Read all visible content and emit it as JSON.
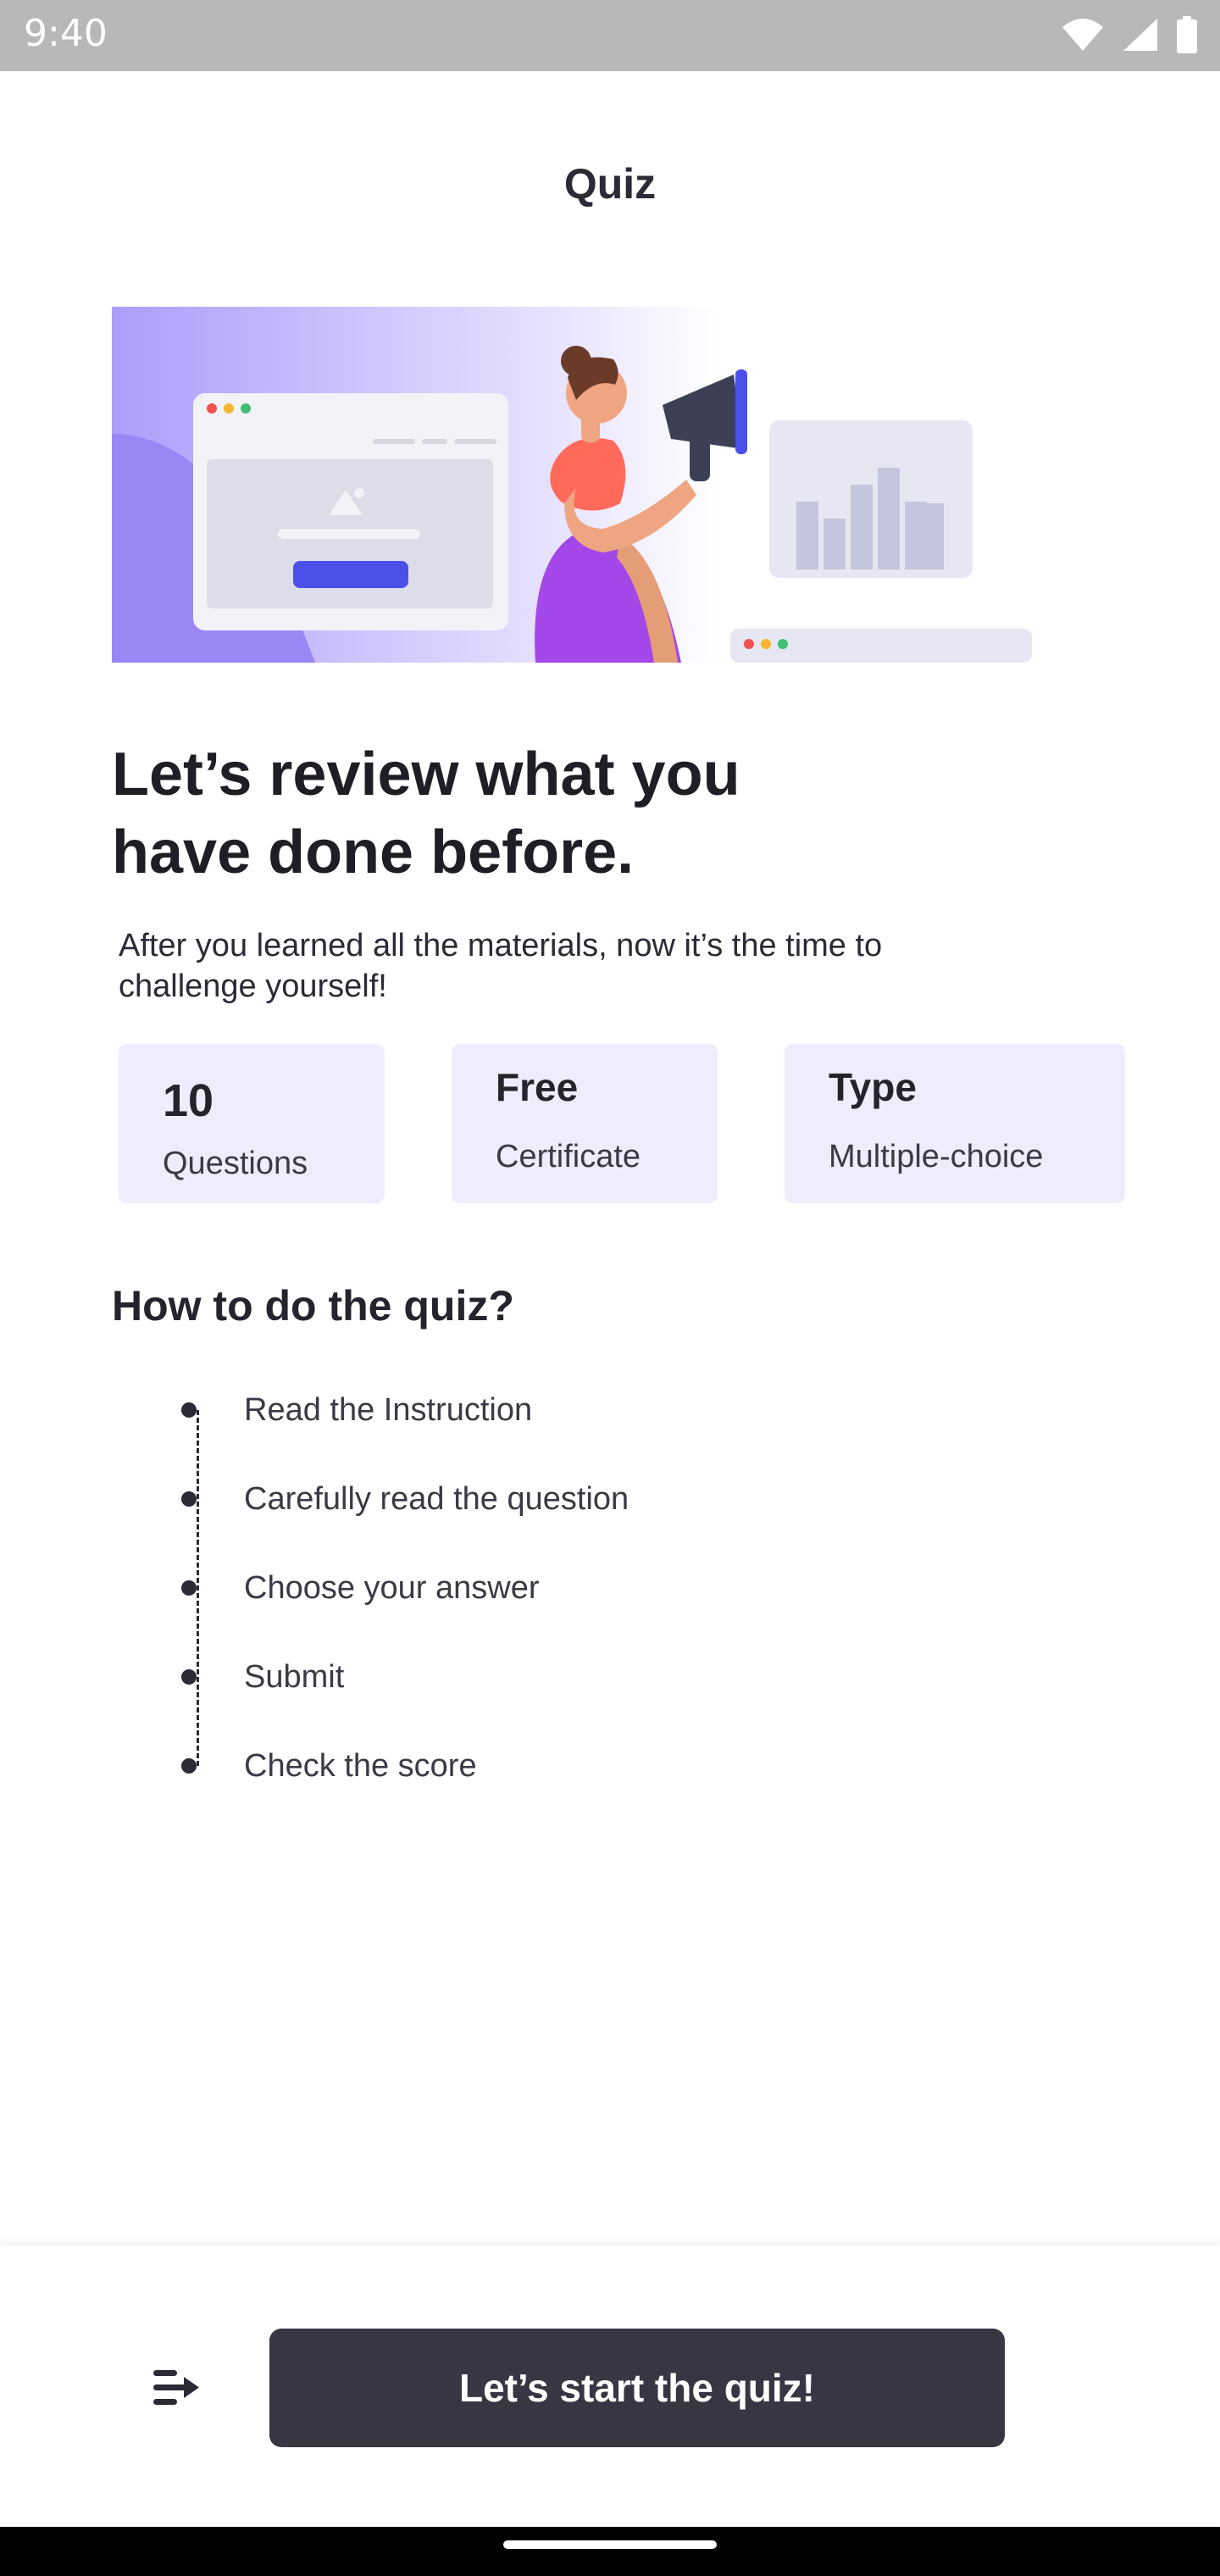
{
  "status_bar": {
    "time": "9:40",
    "icons": [
      "wifi-icon",
      "signal-icon",
      "battery-icon"
    ]
  },
  "header": {
    "title": "Quiz"
  },
  "hero": {
    "illustration": "megaphone-woman-illustration",
    "bg_color": "#ac9dfb",
    "accent_color": "#a347e8"
  },
  "headline": {
    "line1": "Let’s review what you",
    "line2": "have done before."
  },
  "subtitle": {
    "line1": "After you learned all the materials, now it’s the time to",
    "line2": "challenge yourself!"
  },
  "info_cards": [
    {
      "value": "10",
      "label": "Questions"
    },
    {
      "value": "Free",
      "label": "Certificate"
    },
    {
      "value": "Type",
      "label": "Multiple-choice"
    }
  ],
  "how_to": {
    "title": "How to do the quiz?",
    "steps": [
      "Read the Instruction",
      "Carefully read the question",
      "Choose your answer",
      "Submit",
      "Check the score"
    ]
  },
  "footer": {
    "start_label": "Let’s start the quiz!",
    "menu_icon": "list-menu-icon",
    "button_color": "#383642"
  },
  "colors": {
    "card_bg": "#efedfd",
    "text_dark": "#23212b"
  }
}
